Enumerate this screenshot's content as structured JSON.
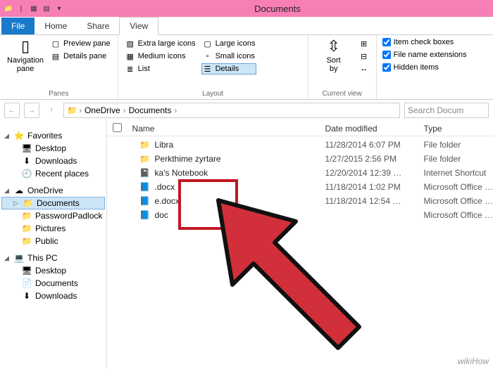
{
  "window": {
    "title": "Documents"
  },
  "tabs": {
    "file": "File",
    "home": "Home",
    "share": "Share",
    "view": "View"
  },
  "ribbon": {
    "panes": {
      "nav": "Navigation\npane",
      "preview": "Preview pane",
      "details_pane": "Details pane",
      "label": "Panes"
    },
    "layout": {
      "xl": "Extra large icons",
      "lg": "Large icons",
      "md": "Medium icons",
      "sm": "Small icons",
      "list": "List",
      "details": "Details",
      "label": "Layout"
    },
    "current": {
      "sort": "Sort\nby",
      "label": "Current view"
    },
    "show": {
      "checkboxes": "Item check boxes",
      "ext": "File name extensions",
      "hidden": "Hidden items"
    }
  },
  "address": {
    "crumbs": [
      "OneDrive",
      "Documents"
    ],
    "search_placeholder": "Search Docum"
  },
  "tree": {
    "favorites": {
      "label": "Favorites",
      "items": [
        "Desktop",
        "Downloads",
        "Recent places"
      ]
    },
    "onedrive": {
      "label": "OneDrive",
      "items": [
        "Documents",
        "PasswordPadlock",
        "Pictures",
        "Public"
      ]
    },
    "thispc": {
      "label": "This PC",
      "items": [
        "Desktop",
        "Documents",
        "Downloads"
      ]
    }
  },
  "columns": {
    "name": "Name",
    "date": "Date modified",
    "type": "Type"
  },
  "files": [
    {
      "icon": "📁",
      "name": "Libra",
      "date": "11/28/2014 6:07 PM",
      "type": "File folder"
    },
    {
      "icon": "📁",
      "name": "Perkthime zyrtare",
      "date": "1/27/2015 2:56 PM",
      "type": "File folder"
    },
    {
      "icon": "📓",
      "name": "ka's Notebook",
      "date": "12/20/2014 12:39 …",
      "type": "Internet Shortcut"
    },
    {
      "icon": "📘",
      "name": ".docx",
      "date": "11/18/2014 1:02 PM",
      "type": "Microsoft Office …"
    },
    {
      "icon": "📘",
      "name": "e.docx",
      "date": "11/18/2014 12:54 …",
      "type": "Microsoft Office …"
    },
    {
      "icon": "📘",
      "name": "doc",
      "date": "",
      "type": "Microsoft Office …"
    }
  ],
  "watermark": "wikiHow"
}
